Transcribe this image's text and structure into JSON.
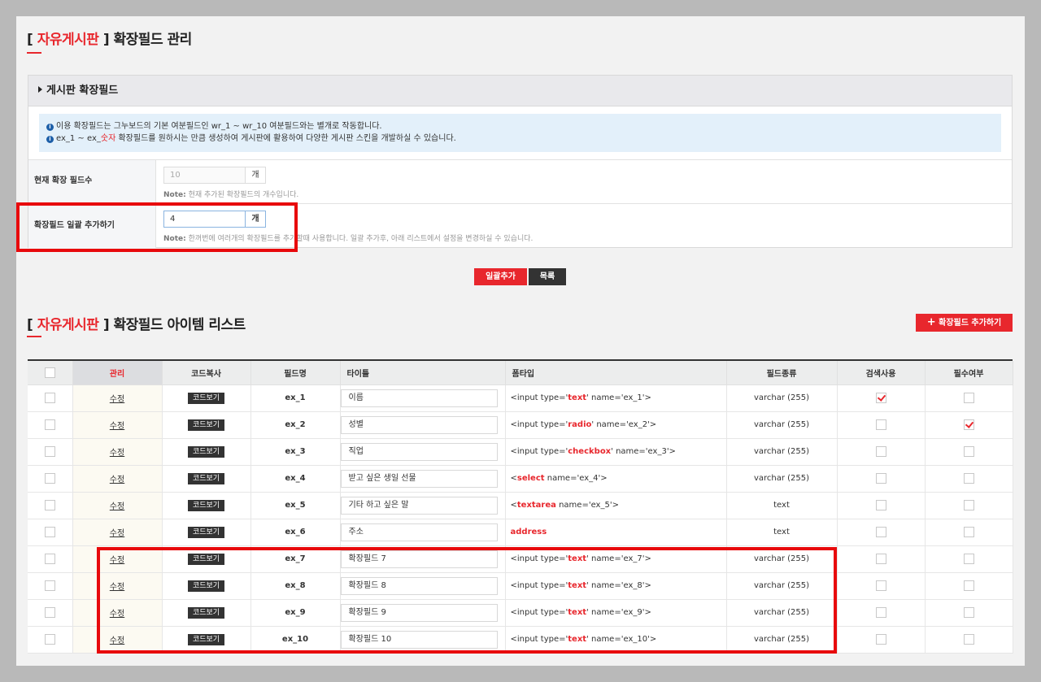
{
  "header": {
    "bracket_open": "[",
    "board_name": "자유게시판",
    "bracket_close": "]",
    "title": "확장필드 관리"
  },
  "panel": {
    "heading": "게시판 확장필드",
    "info_lines": [
      {
        "text": "이용 확장필드는 그누보드의 기본 여분필드인 wr_1 ~ wr_10 여분필드와는 별개로 작동합니다."
      },
      {
        "text_a": "ex_1 ~ ex_",
        "text_red": "숫자",
        "text_b": " 확장필드를 원하시는 만큼 생성하여 게시판에 활용하여 다양한 게시판 스킨을 개발하실 수 있습니다."
      }
    ],
    "current_count": {
      "label": "현재 확장 필드수",
      "value": "10",
      "unit": "개",
      "note_prefix": "Note:",
      "note": " 현재 추가된 확장필드의 개수입니다."
    },
    "bulk_add": {
      "label": "확장필드 일괄 추가하기",
      "value": "4",
      "unit": "개",
      "note_prefix": "Note:",
      "note": " 한꺼번에 여러개의 확장필드를 추가할때 사용합니다. 일괄 추가후, 아래 리스트에서 설정을 변경하실 수 있습니다."
    }
  },
  "buttons": {
    "bulk_add": "일괄추가",
    "list": "목록",
    "add_field": "확장필드 추가하기"
  },
  "list_header": {
    "bracket_open": "[",
    "board_name": "자유게시판",
    "bracket_close": "]",
    "title": "확장필드 아이템 리스트"
  },
  "table": {
    "columns": [
      "관리",
      "코드복사",
      "필드명",
      "타이틀",
      "폼타입",
      "필드종류",
      "검색사용",
      "필수여부"
    ],
    "edit_label": "수정",
    "code_label": "코드보기",
    "rows": [
      {
        "field": "ex_1",
        "title": "이름",
        "form_pre": "<input type='",
        "form_red": "text",
        "form_post": "' name='ex_1'>",
        "kind": "varchar (255)",
        "search": true,
        "required": false
      },
      {
        "field": "ex_2",
        "title": "성별",
        "form_pre": "<input type='",
        "form_red": "radio",
        "form_post": "' name='ex_2'>",
        "kind": "varchar (255)",
        "search": false,
        "required": true
      },
      {
        "field": "ex_3",
        "title": "직업",
        "form_pre": "<input type='",
        "form_red": "checkbox",
        "form_post": "' name='ex_3'>",
        "kind": "varchar (255)",
        "search": false,
        "required": false
      },
      {
        "field": "ex_4",
        "title": "받고 싶은 생일 선물",
        "form_pre": "<",
        "form_red": "select",
        "form_post": " name='ex_4'>",
        "kind": "varchar (255)",
        "search": false,
        "required": false
      },
      {
        "field": "ex_5",
        "title": "기타 하고 싶은 말",
        "form_pre": "<",
        "form_red": "textarea",
        "form_post": " name='ex_5'>",
        "kind": "text",
        "search": false,
        "required": false
      },
      {
        "field": "ex_6",
        "title": "주소",
        "form_pre": "",
        "form_red": "address",
        "form_post": "",
        "kind": "text",
        "search": false,
        "required": false
      },
      {
        "field": "ex_7",
        "title": "확장필드 7",
        "form_pre": "<input type='",
        "form_red": "text",
        "form_post": "' name='ex_7'>",
        "kind": "varchar (255)",
        "search": false,
        "required": false
      },
      {
        "field": "ex_8",
        "title": "확장필드 8",
        "form_pre": "<input type='",
        "form_red": "text",
        "form_post": "' name='ex_8'>",
        "kind": "varchar (255)",
        "search": false,
        "required": false
      },
      {
        "field": "ex_9",
        "title": "확장필드 9",
        "form_pre": "<input type='",
        "form_red": "text",
        "form_post": "' name='ex_9'>",
        "kind": "varchar (255)",
        "search": false,
        "required": false
      },
      {
        "field": "ex_10",
        "title": "확장필드 10",
        "form_pre": "<input type='",
        "form_red": "text",
        "form_post": "' name='ex_10'>",
        "kind": "varchar (255)",
        "search": false,
        "required": false
      }
    ]
  },
  "colors": {
    "accent": "#e8272d",
    "highlight": "#e8090c",
    "dark_button": "#333333"
  }
}
